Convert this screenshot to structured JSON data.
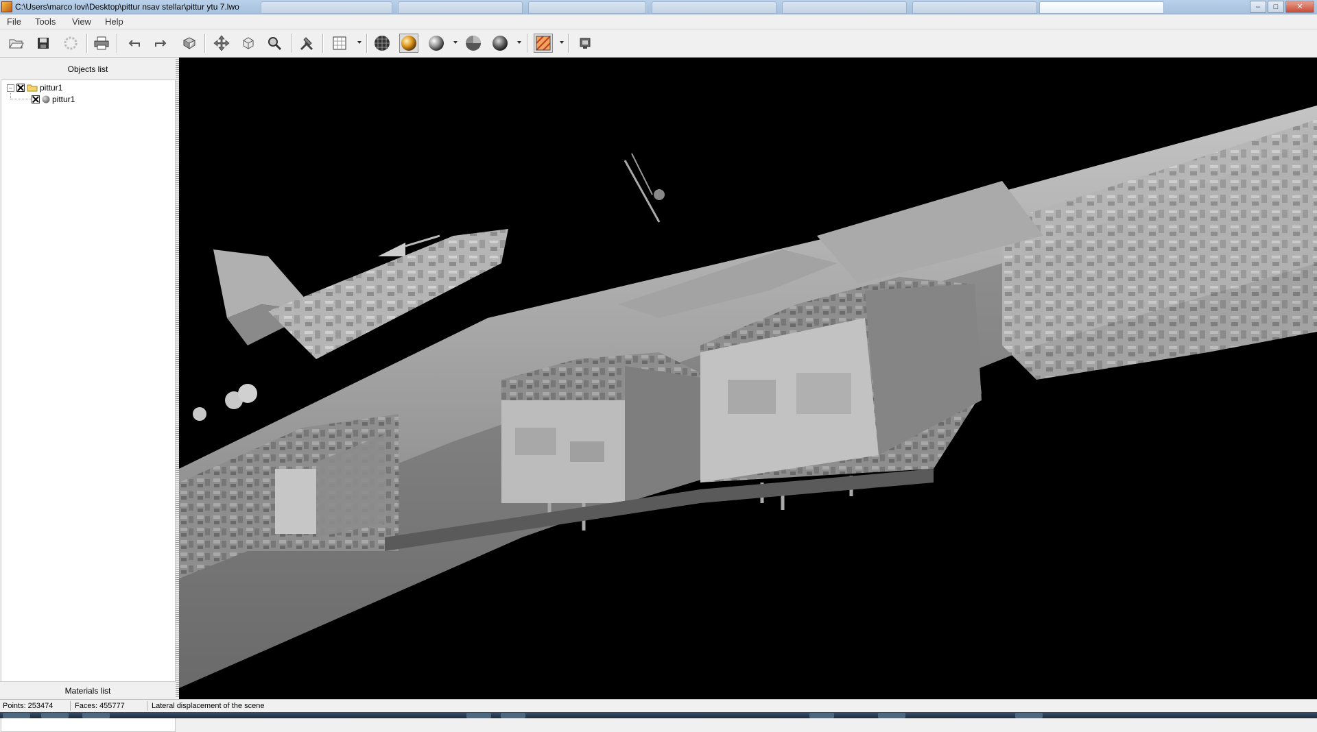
{
  "window": {
    "title": "C:\\Users\\marco lovi\\Desktop\\pittur nsav stellar\\pittur ytu 7.lwo",
    "app_icon": "app-icon",
    "controls": [
      "minimize-icon",
      "maximize-icon",
      "close-icon"
    ]
  },
  "menu": {
    "items": [
      {
        "label": "File"
      },
      {
        "label": "Tools"
      },
      {
        "label": "View"
      },
      {
        "label": "Help"
      }
    ]
  },
  "toolbar": {
    "icons": [
      "open-icon",
      "save-icon",
      "export-icon",
      "print-icon",
      "undo-icon",
      "redo-icon",
      "reset-view-icon",
      "move-icon",
      "rotate-icon",
      "zoom-icon",
      "hammer-icon",
      "grid-icon",
      "wireframe-sphere-icon",
      "gold-shaded-sphere-icon",
      "smooth-sphere-icon",
      "flat-sphere-icon",
      "dark-sphere-icon",
      "texture-icon",
      "screenshot-icon"
    ],
    "pressed": [
      "gold-shaded-sphere-icon",
      "texture-icon"
    ]
  },
  "objects_panel": {
    "title": "Objects list",
    "tree": [
      {
        "label": "pittur1",
        "type": "folder",
        "checked": true,
        "expanded": true,
        "children": [
          {
            "label": "pittur1",
            "type": "mesh",
            "checked": true
          }
        ]
      }
    ]
  },
  "materials_panel": {
    "title": "Materials list"
  },
  "viewport": {
    "background": "#000000",
    "model_color": "#9a9a9a"
  },
  "status": {
    "points": "Points: 253474",
    "faces": "Faces: 455777",
    "message": "Lateral displacement of the scene"
  }
}
